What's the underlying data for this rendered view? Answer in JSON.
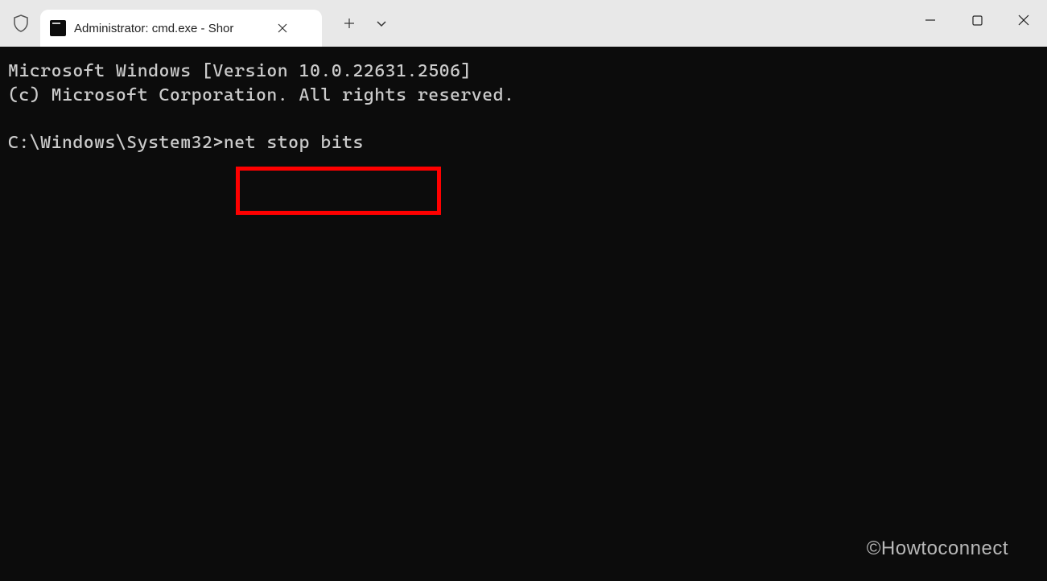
{
  "titlebar": {
    "tab_title": "Administrator: cmd.exe - Shor",
    "tab_icon_name": "cmd-terminal-icon"
  },
  "terminal": {
    "banner_line1": "Microsoft Windows [Version 10.0.22631.2506]",
    "banner_line2": "(c) Microsoft Corporation. All rights reserved.",
    "prompt": "C:\\Windows\\System32>",
    "command": "net stop bits"
  },
  "watermark": "©Howtoconnect",
  "highlight": {
    "color": "#ff0000"
  }
}
